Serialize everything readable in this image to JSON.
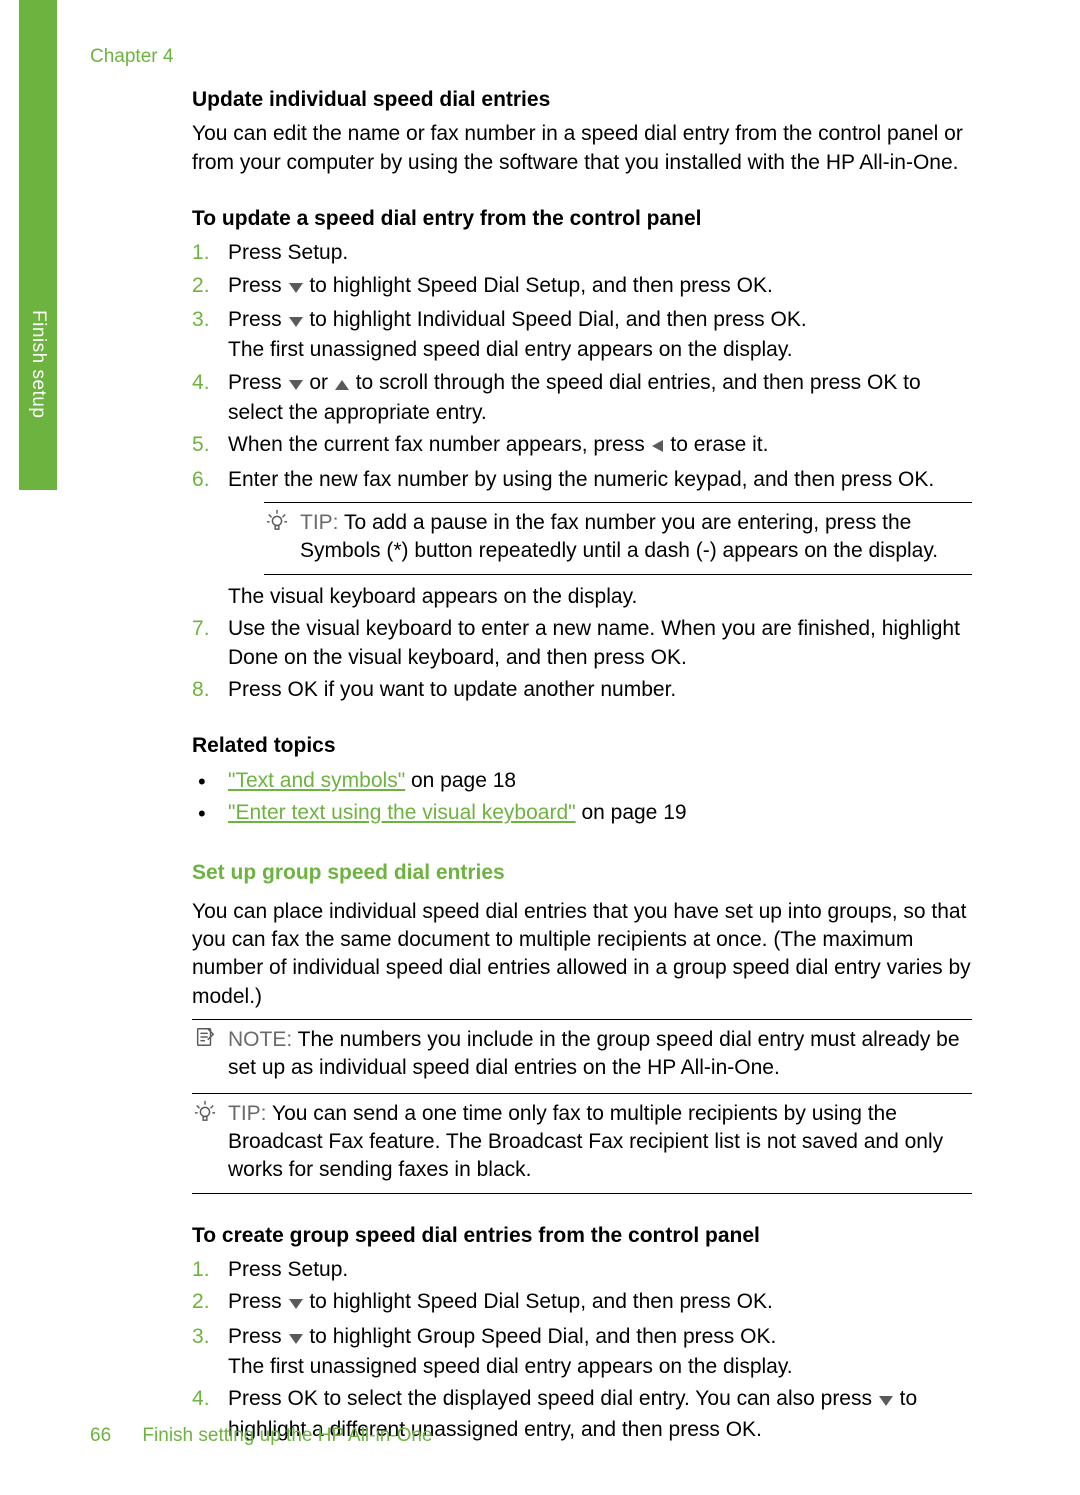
{
  "tab_label": "Finish setup",
  "chapter": "Chapter 4",
  "sec1": {
    "heading": "Update individual speed dial entries",
    "intro": "You can edit the name or fax number in a speed dial entry from the control panel or from your computer by using the software that you installed with the HP All-in-One.",
    "procedure_heading": "To update a speed dial entry from the control panel",
    "steps": {
      "s1": "Press Setup.",
      "s2a": "Press ",
      "s2b": " to highlight Speed Dial Setup, and then press OK.",
      "s3a": "Press ",
      "s3b": " to highlight Individual Speed Dial, and then press OK.",
      "s3c": "The first unassigned speed dial entry appears on the display.",
      "s4a": "Press ",
      "s4b": " or ",
      "s4c": " to scroll through the speed dial entries, and then press OK to select the appropriate entry.",
      "s5a": "When the current fax number appears, press ",
      "s5b": " to erase it.",
      "s6": "Enter the new fax number by using the numeric keypad, and then press OK.",
      "tip_label": "TIP:",
      "tip_body": "To add a pause in the fax number you are entering, press the Symbols (*) button repeatedly until a dash (-) appears on the display.",
      "s6_after": "The visual keyboard appears on the display.",
      "s7": "Use the visual keyboard to enter a new name. When you are finished, highlight Done on the visual keyboard, and then press OK.",
      "s8": "Press OK if you want to update another number."
    },
    "related_heading": "Related topics",
    "related": {
      "r1_link": "\"Text and symbols\"",
      "r1_suffix": " on page 18",
      "r2_link": "\"Enter text using the visual keyboard\"",
      "r2_suffix": " on page 19"
    }
  },
  "sec2": {
    "heading": "Set up group speed dial entries",
    "intro": "You can place individual speed dial entries that you have set up into groups, so that you can fax the same document to multiple recipients at once. (The maximum number of individual speed dial entries allowed in a group speed dial entry varies by model.)",
    "note_label": "NOTE:",
    "note_body": "The numbers you include in the group speed dial entry must already be set up as individual speed dial entries on the HP All-in-One.",
    "tip_label": "TIP:",
    "tip_body": "You can send a one time only fax to multiple recipients by using the Broadcast Fax feature. The Broadcast Fax recipient list is not saved and only works for sending faxes in black.",
    "procedure_heading": "To create group speed dial entries from the control panel",
    "steps": {
      "s1": "Press Setup.",
      "s2a": "Press ",
      "s2b": " to highlight Speed Dial Setup, and then press OK.",
      "s3a": "Press ",
      "s3b": " to highlight Group Speed Dial, and then press OK.",
      "s3c": "The first unassigned speed dial entry appears on the display.",
      "s4a": "Press OK to select the displayed speed dial entry. You can also press ",
      "s4b": " to highlight a different unassigned entry, and then press OK."
    }
  },
  "footer": {
    "page": "66",
    "text": "Finish setting up the HP All-in-One"
  }
}
